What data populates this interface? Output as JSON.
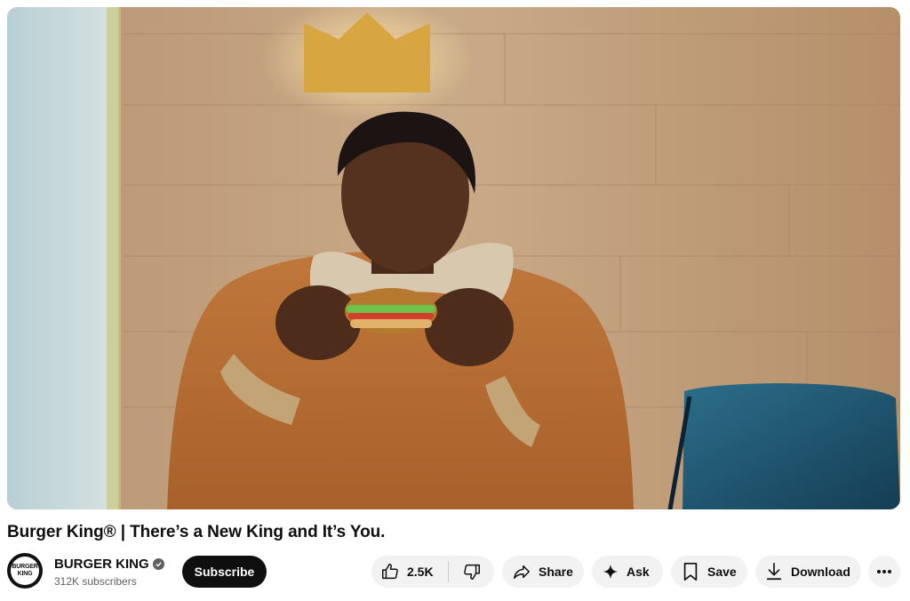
{
  "video": {
    "title": "Burger King® | There’s a New King and It’s You.",
    "thumbnail": "man-eating-burger-under-crown-light"
  },
  "channel": {
    "name": "BURGER KING",
    "subscribers": "312K subscribers",
    "avatar_line1": "BURGER",
    "avatar_line2": "KING",
    "verified_icon": "verified-check-icon"
  },
  "actions": {
    "subscribe_label": "Subscribe",
    "like_count": "2.5K",
    "share_label": "Share",
    "ask_label": "Ask",
    "save_label": "Save",
    "download_label": "Download",
    "more_icon": "more-horizontal-icon"
  },
  "colors": {
    "subscribe_bg": "#0f0f0f",
    "pill_bg": "#f2f2f2",
    "secondary_text": "#606060"
  }
}
